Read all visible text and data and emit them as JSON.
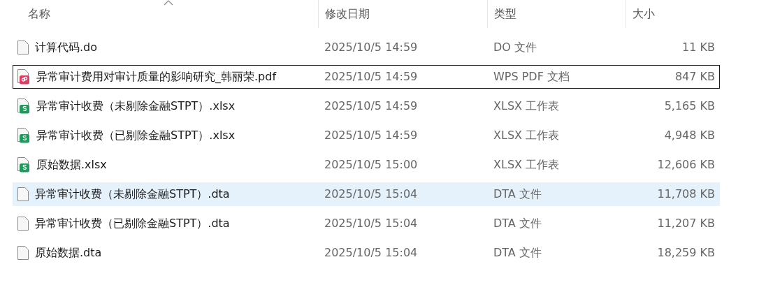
{
  "columns": [
    {
      "label": "名称",
      "sorted": true
    },
    {
      "label": "修改日期",
      "sorted": false
    },
    {
      "label": "类型",
      "sorted": false
    },
    {
      "label": "大小",
      "sorted": false
    }
  ],
  "files": [
    {
      "kind": "doc",
      "name": "计算代码.do",
      "modified": "2025/10/5 14:59",
      "type": "DO 文件",
      "size": "11 KB",
      "selected": false,
      "focused": false
    },
    {
      "kind": "pdf",
      "name": "异常审计费用对审计质量的影响研究_韩丽荣.pdf",
      "modified": "2025/10/5 14:59",
      "type": "WPS PDF 文档",
      "size": "847 KB",
      "selected": false,
      "focused": true
    },
    {
      "kind": "sheet",
      "name": "异常审计收费（未剔除金融STPT）.xlsx",
      "modified": "2025/10/5 14:59",
      "type": "XLSX 工作表",
      "size": "5,165 KB",
      "selected": false,
      "focused": false
    },
    {
      "kind": "sheet",
      "name": "异常审计收费（已剔除金融STPT）.xlsx",
      "modified": "2025/10/5 14:59",
      "type": "XLSX 工作表",
      "size": "4,948 KB",
      "selected": false,
      "focused": false
    },
    {
      "kind": "sheet",
      "name": "原始数据.xlsx",
      "modified": "2025/10/5 15:00",
      "type": "XLSX 工作表",
      "size": "12,606 KB",
      "selected": false,
      "focused": false
    },
    {
      "kind": "doc",
      "name": "异常审计收费（未剔除金融STPT）.dta",
      "modified": "2025/10/5 15:04",
      "type": "DTA 文件",
      "size": "11,708 KB",
      "selected": true,
      "focused": false
    },
    {
      "kind": "doc",
      "name": "异常审计收费（已剔除金融STPT）.dta",
      "modified": "2025/10/5 15:04",
      "type": "DTA 文件",
      "size": "11,207 KB",
      "selected": false,
      "focused": false
    },
    {
      "kind": "doc",
      "name": "原始数据.dta",
      "modified": "2025/10/5 15:04",
      "type": "DTA 文件",
      "size": "18,259 KB",
      "selected": false,
      "focused": false
    }
  ]
}
